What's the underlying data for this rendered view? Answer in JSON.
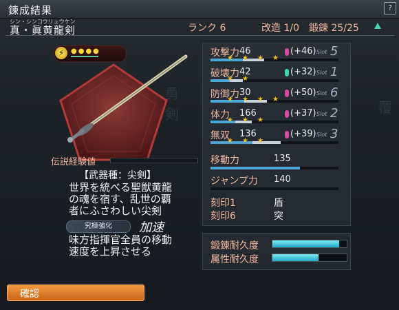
{
  "header": {
    "title": "鍊成結果",
    "help": "?",
    "weapon_ruby": "シン・シンコウリュウケン",
    "weapon_name": "真・眞黄龍剣",
    "rank": "ランク 6",
    "kaizo": "改造 1/0",
    "tanren": "鍛錬 25/25"
  },
  "weapon": {
    "level_dots": "●●●●",
    "exp_label": "伝説経験値",
    "category": "【武器種：尖剣】",
    "description": "世界を統べる聖獣黄龍\nの魂を宿す、乱世の覇\n者にふさわしい尖剣",
    "skill_tag": "究極強化",
    "skill_name": "加速",
    "skill_description": "味方指揮官全員の移動\n速度を上昇させる"
  },
  "stats": [
    {
      "name": "攻撃力",
      "value": "46",
      "bonus": "(+46)",
      "gem": "#d64aa5",
      "slot_label": "Slot",
      "slot": "5",
      "fill": 0.42,
      "stars": 4
    },
    {
      "name": "破壊力",
      "value": "42",
      "bonus": "(+32)",
      "gem": "#3fd6b0",
      "slot_label": "Slot",
      "slot": "1",
      "fill": 0.25,
      "stars": 2
    },
    {
      "name": "防御力",
      "value": "30",
      "bonus": "(+50)",
      "gem": "#d64aa5",
      "slot_label": "Slot",
      "slot": "6",
      "fill": 0.44,
      "stars": 4
    },
    {
      "name": "体力",
      "value": "166",
      "bonus": "(+37)",
      "gem": "#d64aa5",
      "slot_label": "Slot",
      "slot": "2",
      "fill": 0.32,
      "stars": 3
    },
    {
      "name": "無双",
      "value": "136",
      "bonus": "(+39)",
      "gem": "#d64aa5",
      "slot_label": "Slot",
      "slot": "3",
      "fill": 0.55,
      "stars": 3
    }
  ],
  "extra": {
    "move_label": "移動力",
    "move_value": "135",
    "jump_label": "ジャンプ力",
    "jump_value": "140",
    "seal1_label": "刻印1",
    "seal1_value": "盾",
    "seal6_label": "刻印6",
    "seal6_value": "突"
  },
  "durability": {
    "forge_label": "鍛錬耐久度",
    "forge_fill": 0.9,
    "attr_label": "属性耐久度",
    "attr_fill": 0.62
  },
  "footer": {
    "confirm_label": "確認"
  },
  "colors": {
    "accent": "#f0b8a0",
    "gem_pink": "#d64aa5",
    "gem_green": "#3fd6b0",
    "confirm": "#e07a2a",
    "gauge": "#49a6d6"
  }
}
